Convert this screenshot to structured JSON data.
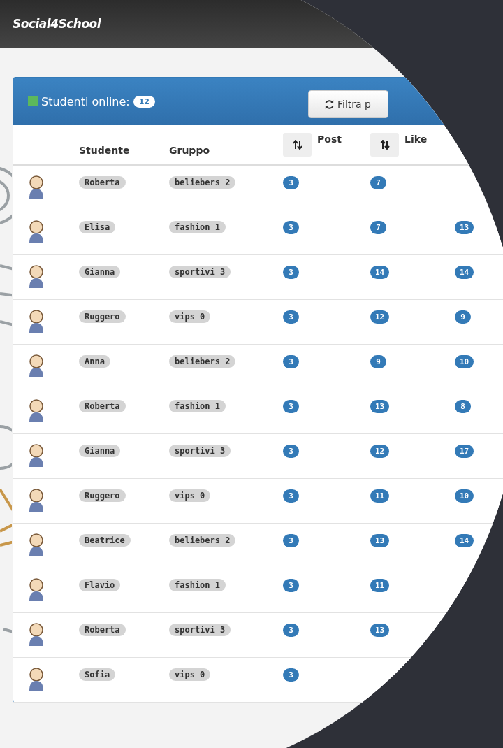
{
  "header": {
    "logo": "Social4School"
  },
  "panel": {
    "title": "Studenti online:",
    "count": "12",
    "filter_button": "Filtra p"
  },
  "table": {
    "columns": [
      {
        "label": "Studente",
        "sortable": false
      },
      {
        "label": "Gruppo",
        "sortable": false
      },
      {
        "label": "Post",
        "sortable": true
      },
      {
        "label": "Like",
        "sortable": true
      }
    ],
    "rows": [
      {
        "student": "Roberta",
        "group": "beliebers 2",
        "post": "3",
        "like": "7"
      },
      {
        "student": "Elisa",
        "group": "fashion 1",
        "post": "3",
        "like": "7",
        "column_5": "13"
      },
      {
        "student": "Gianna",
        "group": "sportivi 3",
        "post": "3",
        "like": "14",
        "column_5": "14"
      },
      {
        "student": "Ruggero",
        "group": "vips 0",
        "post": "3",
        "like": "12",
        "column_5": "9"
      },
      {
        "student": "Anna",
        "group": "beliebers 2",
        "post": "3",
        "like": "9",
        "column_5": "10"
      },
      {
        "student": "Roberta",
        "group": "fashion 1",
        "post": "3",
        "like": "13",
        "column_5": "8"
      },
      {
        "student": "Gianna",
        "group": "sportivi 3",
        "post": "3",
        "like": "12",
        "column_5": "17"
      },
      {
        "student": "Ruggero",
        "group": "vips 0",
        "post": "3",
        "like": "11",
        "column_5": "10"
      },
      {
        "student": "Beatrice",
        "group": "beliebers 2",
        "post": "3",
        "like": "13",
        "column_5": "14"
      },
      {
        "student": "Flavio",
        "group": "fashion 1",
        "post": "3",
        "like": "11"
      },
      {
        "student": "Roberta",
        "group": "sportivi 3",
        "post": "3",
        "like": "13"
      },
      {
        "student": "Sofia",
        "group": "vips 0",
        "post": "3"
      }
    ]
  }
}
